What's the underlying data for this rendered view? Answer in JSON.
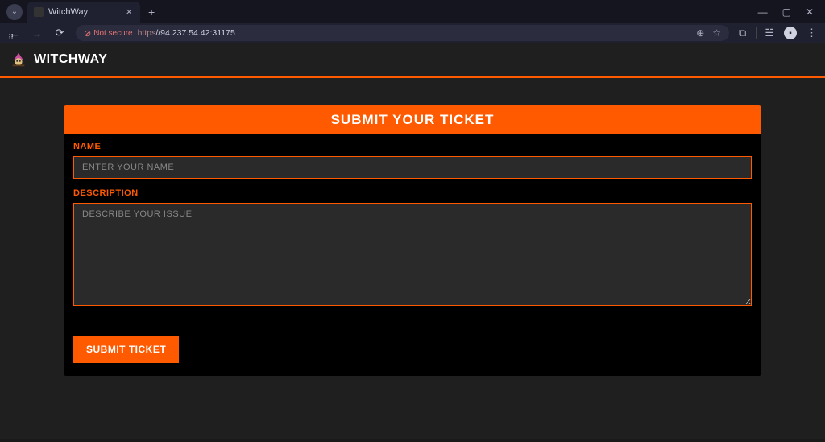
{
  "browser": {
    "tab": {
      "title": "WitchWay"
    },
    "url": {
      "security_badge": "Not secure",
      "protocol": "https",
      "host": "//94.237.54.42:31175"
    }
  },
  "site": {
    "brand": "WitchWay"
  },
  "form": {
    "title": "Submit Your Ticket",
    "name": {
      "label": "Name",
      "placeholder": "Enter your name",
      "value": ""
    },
    "description": {
      "label": "Description",
      "placeholder": "Describe your issue",
      "value": ""
    },
    "submit_label": "Submit Ticket"
  },
  "colors": {
    "accent": "#ff5a00",
    "page_bg": "#1f1f1f",
    "card_bg": "#000000",
    "input_bg": "#2a2a2a"
  }
}
